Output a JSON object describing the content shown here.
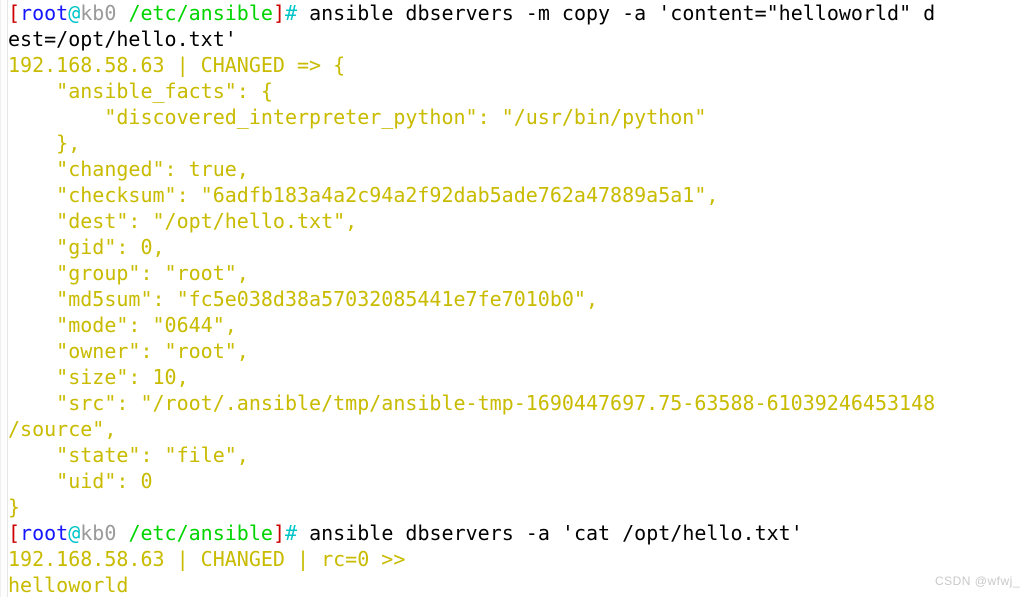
{
  "terminal": {
    "prompt": {
      "bracket_open": "[",
      "user": "root",
      "at": "@",
      "host": "kb0",
      "space": " ",
      "cwd": "/etc/ansible",
      "bracket_close": "]",
      "sigil": "#"
    },
    "colors": {
      "background": "#ffffff",
      "bracket": "#cc0000",
      "user": "#1515ff",
      "at": "#00c5c7",
      "host": "#9a9a9a",
      "cwd": "#00d400",
      "sigil": "#00c5c7",
      "command": "#000000",
      "output": "#c8bb00"
    },
    "lines": [
      {
        "type": "prompt",
        "command": " ansible dbservers -m copy -a 'content=\"helloworld\" d"
      },
      {
        "type": "command-wrap",
        "text": "est=/opt/hello.txt'"
      },
      {
        "type": "output",
        "text": "192.168.58.63 | CHANGED => {"
      },
      {
        "type": "output",
        "text": "    \"ansible_facts\": {"
      },
      {
        "type": "output",
        "text": "        \"discovered_interpreter_python\": \"/usr/bin/python\""
      },
      {
        "type": "output",
        "text": "    },"
      },
      {
        "type": "output",
        "text": "    \"changed\": true,"
      },
      {
        "type": "output",
        "text": "    \"checksum\": \"6adfb183a4a2c94a2f92dab5ade762a47889a5a1\","
      },
      {
        "type": "output",
        "text": "    \"dest\": \"/opt/hello.txt\","
      },
      {
        "type": "output",
        "text": "    \"gid\": 0,"
      },
      {
        "type": "output",
        "text": "    \"group\": \"root\","
      },
      {
        "type": "output",
        "text": "    \"md5sum\": \"fc5e038d38a57032085441e7fe7010b0\","
      },
      {
        "type": "output",
        "text": "    \"mode\": \"0644\","
      },
      {
        "type": "output",
        "text": "    \"owner\": \"root\","
      },
      {
        "type": "output",
        "text": "    \"size\": 10,"
      },
      {
        "type": "output",
        "text": "    \"src\": \"/root/.ansible/tmp/ansible-tmp-1690447697.75-63588-61039246453148"
      },
      {
        "type": "output",
        "text": "/source\","
      },
      {
        "type": "output",
        "text": "    \"state\": \"file\","
      },
      {
        "type": "output",
        "text": "    \"uid\": 0"
      },
      {
        "type": "output",
        "text": "}"
      },
      {
        "type": "prompt",
        "command": " ansible dbservers -a 'cat /opt/hello.txt'"
      },
      {
        "type": "output",
        "text": "192.168.58.63 | CHANGED | rc=0 >>"
      },
      {
        "type": "output",
        "text": "helloworld"
      }
    ]
  },
  "watermark": {
    "text": "CSDN @wfwj_"
  }
}
